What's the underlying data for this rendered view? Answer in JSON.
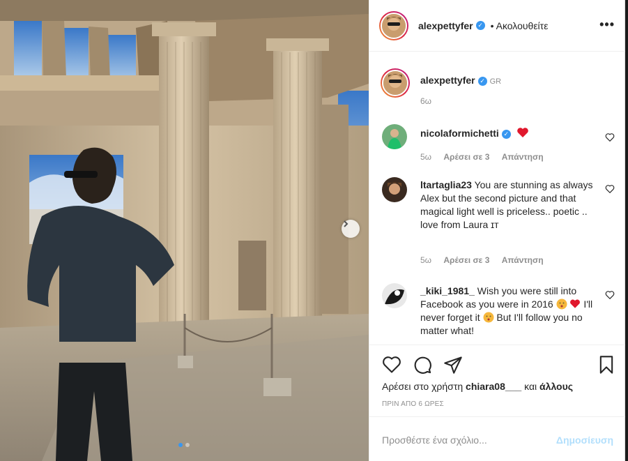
{
  "header": {
    "username": "alexpettyfer",
    "follow_label": "• Ακολουθείτε",
    "more_label": "•••"
  },
  "caption": {
    "username": "alexpettyfer",
    "location_tag": "GR",
    "time": "6ω"
  },
  "comments": [
    {
      "username": "nicolaformichetti",
      "text": "",
      "time": "5ω",
      "likes": "Αρέσει σε 3",
      "reply": "Απάντηση"
    },
    {
      "username": "ltartaglia23",
      "text": "You are stunning as always Alex but the second picture and that magical light well is priceless.. poetic .. love from Laura ɪᴛ",
      "time": "5ω",
      "likes": "Αρέσει σε 3",
      "reply": "Απάντηση"
    },
    {
      "username": "_kiki_1981_",
      "text_a": "Wish you were still into Facebook as you were in 2016",
      "text_b": "I'll never forget it",
      "text_c": "But I'll follow you no matter what!"
    }
  ],
  "likes": {
    "prefix": "Αρέσει στο χρήστη",
    "user": "chiara08___",
    "and": "και",
    "others": "άλλους"
  },
  "post_time": "ΠΡΙΝ ΑΠΟ 6 ΩΡΕΣ",
  "add_comment": {
    "placeholder": "Προσθέστε ένα σχόλιο...",
    "post_label": "Δημοσίευση"
  },
  "icons": [
    "heart-icon",
    "comment-icon",
    "share-icon",
    "bookmark-icon",
    "verified-icon",
    "chevron-right-icon",
    "more-icon"
  ],
  "colors": {
    "accent": "#3897f0",
    "heart_red": "#ed4956",
    "muted": "#8e8e8e",
    "post_disabled": "#b2dffc"
  },
  "carousel": {
    "total": 2,
    "current": 1
  }
}
